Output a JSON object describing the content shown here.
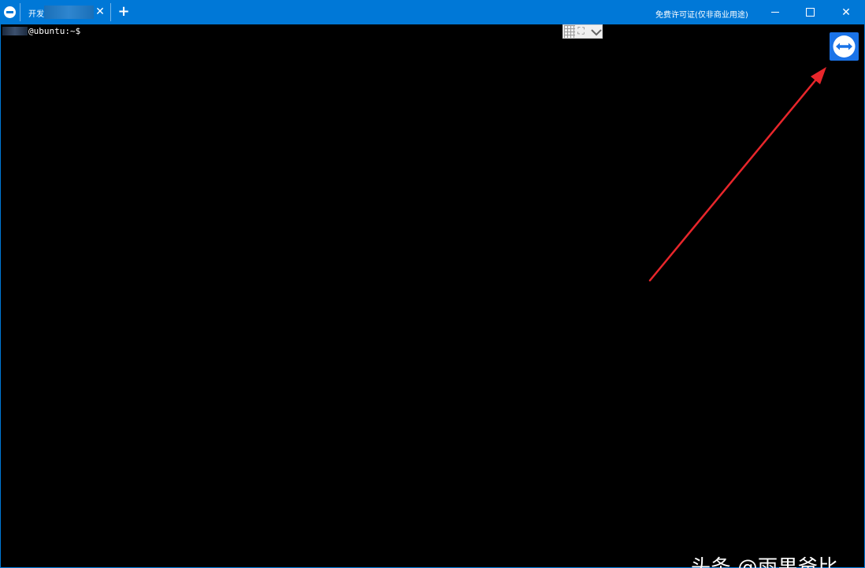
{
  "titlebar": {
    "tab": {
      "label": "开发",
      "close_glyph": "✕"
    },
    "new_tab_glyph": "+",
    "license_text": "免费许可证(仅非商业用途)",
    "window_controls": {
      "close_glyph": "✕"
    }
  },
  "terminal": {
    "prompt": "@ubuntu:~$"
  },
  "watermark": "头条 @雨果爸比",
  "colors": {
    "titlebar": "#0078d7",
    "terminal_bg": "#000000",
    "logo": "#1a73e8",
    "annotation_arrow": "#e8262b"
  },
  "icons": {
    "app": "teamviewer-icon",
    "logo": "teamviewer-logo-icon",
    "grid": "grid-icon",
    "fit": "fit-screen-icon",
    "dropdown": "chevron-down-icon"
  }
}
